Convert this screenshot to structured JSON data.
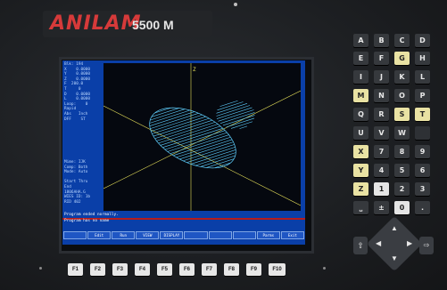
{
  "brand": {
    "name": "ANILAM",
    "model": "5500 M"
  },
  "status_top": [
    "Blk: 194",
    "X    0.0000",
    "Y    0.0000",
    "Z    0.0000",
    "F  200.0",
    "T     0",
    "D    0.0000",
    "L    0.0000",
    "Loop:    0",
    "Rapid",
    "Abs   Inch",
    "DFF    ST"
  ],
  "status_low": [
    "Mime: IJK",
    "Comp: Both",
    "Mode: Auto",
    "",
    "Start Thru",
    "End",
    "1806AHA.G",
    "WIES ID: 1b",
    "RID 402"
  ],
  "messages": {
    "line1": "Program ended normally.",
    "line2": "Program has no name"
  },
  "softkeys": [
    "",
    "Edit",
    "Run",
    "VIEW",
    "DISPLAY",
    "",
    "",
    "",
    "Parms",
    "Exit"
  ],
  "axis_label_z": "Z",
  "keypad": [
    [
      {
        "label": "A",
        "style": "dk"
      },
      {
        "label": "B",
        "style": "dk"
      },
      {
        "label": "C",
        "style": "dk"
      },
      {
        "label": "D",
        "style": "dk"
      }
    ],
    [
      {
        "label": "E",
        "style": "dk"
      },
      {
        "label": "F",
        "style": "dk"
      },
      {
        "label": "G",
        "style": "y"
      },
      {
        "label": "H",
        "style": "dk"
      }
    ],
    [
      {
        "label": "I",
        "style": "dk"
      },
      {
        "label": "J",
        "style": "dk"
      },
      {
        "label": "K",
        "style": "dk"
      },
      {
        "label": "L",
        "style": "dk"
      }
    ],
    [
      {
        "label": "M",
        "style": "y"
      },
      {
        "label": "N",
        "style": "dk"
      },
      {
        "label": "O",
        "style": "dk"
      },
      {
        "label": "P",
        "style": "dk"
      }
    ],
    [
      {
        "label": "Q",
        "style": "dk"
      },
      {
        "label": "R",
        "style": "dk"
      },
      {
        "label": "S",
        "style": "y"
      },
      {
        "label": "T",
        "style": "y"
      }
    ],
    [
      {
        "label": "U",
        "style": "dk"
      },
      {
        "label": "V",
        "style": "dk"
      },
      {
        "label": "W",
        "style": "dk"
      },
      {
        "label": "",
        "style": "gh"
      }
    ],
    [
      {
        "label": "X",
        "style": "y"
      },
      {
        "label": "7",
        "style": "dk"
      },
      {
        "label": "8",
        "style": "dk"
      },
      {
        "label": "9",
        "style": "dk"
      }
    ],
    [
      {
        "label": "Y",
        "style": "y"
      },
      {
        "label": "4",
        "style": "dk"
      },
      {
        "label": "5",
        "style": "dk"
      },
      {
        "label": "6",
        "style": "dk"
      }
    ],
    [
      {
        "label": "Z",
        "style": "y"
      },
      {
        "label": "1",
        "style": "w"
      },
      {
        "label": "2",
        "style": "dk"
      },
      {
        "label": "3",
        "style": "dk"
      }
    ],
    [
      {
        "label": "⎵",
        "style": "dk"
      },
      {
        "label": "±",
        "style": "dk"
      },
      {
        "label": "0",
        "style": "w"
      },
      {
        "label": ".",
        "style": "dk"
      }
    ]
  ],
  "arrows": {
    "left": "⇧",
    "right": "⇨",
    "up": "▲",
    "down": "▼",
    "west": "◀",
    "east": "▶"
  },
  "function_keys": [
    "F1",
    "F2",
    "F3",
    "F4",
    "F5",
    "F6",
    "F7",
    "F8",
    "F9",
    "F10"
  ],
  "colors": {
    "screen_bg": "#0a3fa8",
    "plot_bg": "#05080f",
    "toolpath": "#5fd0ff",
    "axis": "#e8e25a",
    "brand": "#d63a3a",
    "message_bar": "#b51d1d"
  }
}
